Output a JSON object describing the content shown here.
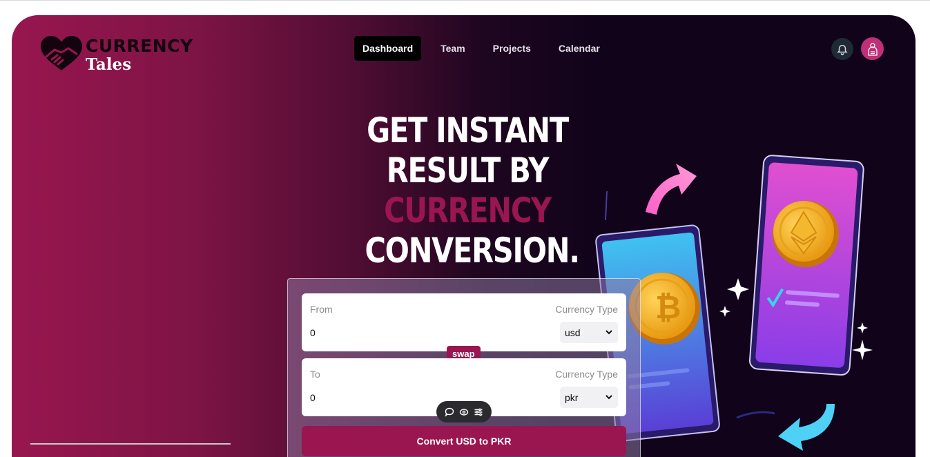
{
  "brand": {
    "name_top": "CURRENCY",
    "name_bottom": "Tales",
    "accent_color": "#9a1650"
  },
  "nav": {
    "items": [
      {
        "label": "Dashboard",
        "active": true
      },
      {
        "label": "Team",
        "active": false
      },
      {
        "label": "Projects",
        "active": false
      },
      {
        "label": "Calendar",
        "active": false
      }
    ]
  },
  "header_icons": [
    "bell-icon",
    "user-avatar"
  ],
  "hero": {
    "line1": "GET INSTANT RESULT BY",
    "line2_accent": "CURRENCY",
    "line2_rest": " CONVERSION."
  },
  "converter": {
    "from": {
      "label": "From",
      "type_label": "Currency Type",
      "value": "0",
      "currency": "usd"
    },
    "to": {
      "label": "To",
      "type_label": "Currency Type",
      "value": "0",
      "currency": "pkr"
    },
    "swap_label": "swap",
    "convert_label": "Convert USD to PKR"
  },
  "floating_toolbar": [
    "comment-icon",
    "eye-icon",
    "sliders-icon"
  ]
}
